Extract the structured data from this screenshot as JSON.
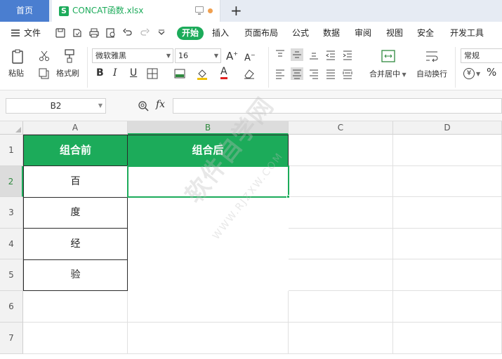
{
  "tabs": {
    "home": "首页",
    "file_icon": "S",
    "file_name": "CONCAT函数.xlsx",
    "new_tab": "+"
  },
  "menu": {
    "file": "文件",
    "start": "开始",
    "items": [
      "插入",
      "页面布局",
      "公式",
      "数据",
      "审阅",
      "视图",
      "安全",
      "开发工具"
    ]
  },
  "ribbon": {
    "paste": "粘贴",
    "format_painter": "格式刷",
    "font_name": "微软雅黑",
    "font_size": "16",
    "bold": "B",
    "italic": "I",
    "underline": "U",
    "merge_center": "合并居中",
    "auto_wrap": "自动换行",
    "number_format": "常规",
    "percent": "%",
    "grow_font": "A",
    "shrink_font": "A",
    "font_color": "A",
    "currency": "¥"
  },
  "formula_bar": {
    "cell_ref": "B2",
    "fx_label": "fx",
    "value": ""
  },
  "sheet": {
    "columns": [
      "A",
      "B",
      "C",
      "D"
    ],
    "rows": [
      "1",
      "2",
      "3",
      "4",
      "5",
      "6",
      "7"
    ],
    "header_a": "组合前",
    "header_b": "组合后",
    "values_a": [
      "百",
      "度",
      "经",
      "验"
    ],
    "selected_cell": "B2",
    "accent_color": "#1cab5a"
  },
  "watermark": {
    "text": "软件自学网",
    "url": "WWW.RJZXW.COM"
  }
}
